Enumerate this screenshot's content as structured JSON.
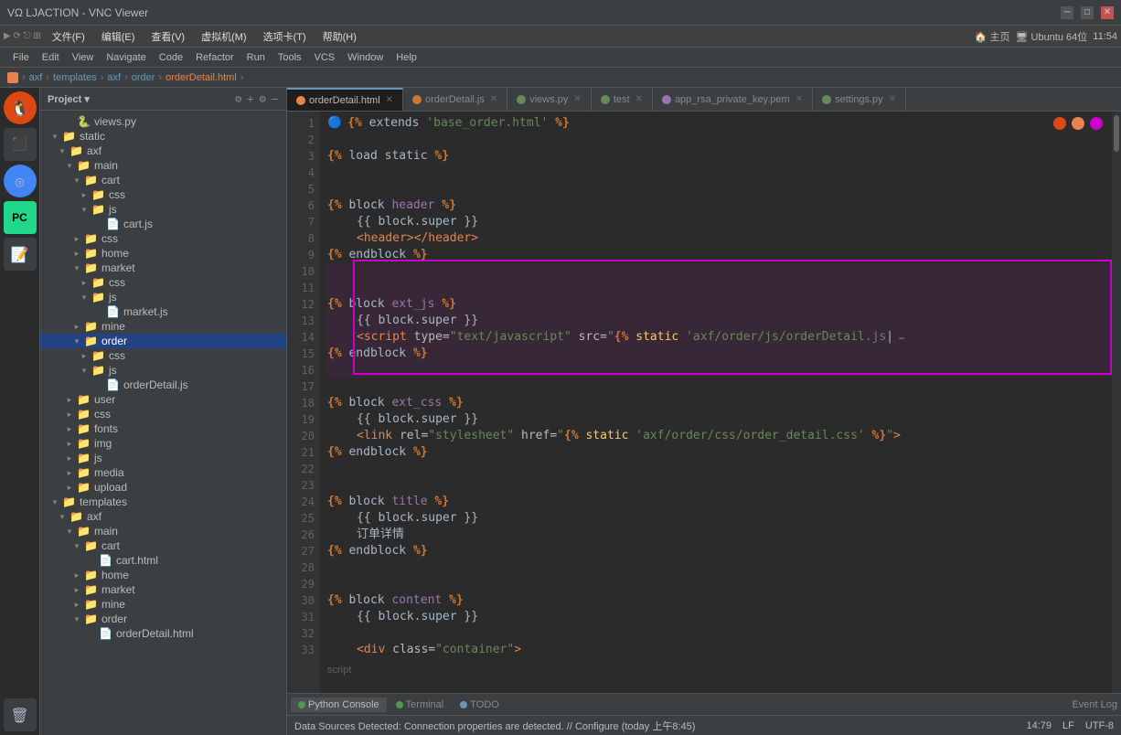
{
  "window": {
    "title": "VΩ LJACTION - VNC Viewer",
    "controls": [
      "minimize",
      "maximize",
      "close"
    ]
  },
  "vnc_toolbar": {
    "items": [
      "文件(F)",
      "编辑(E)",
      "查看(V)",
      "虚拟机(M)",
      "选项卡(T)",
      "帮助(H)"
    ]
  },
  "toolbar_right": {
    "label": "Ubuntu 64位",
    "time": "11:54"
  },
  "ide_menu": {
    "items": [
      "File",
      "Edit",
      "View",
      "Navigate",
      "Code",
      "Refactor",
      "Run",
      "Tools",
      "VCS",
      "Window",
      "Help"
    ]
  },
  "breadcrumb": {
    "items": [
      "axf",
      "templates",
      "axf",
      "order",
      "orderDetail.html"
    ]
  },
  "project_panel": {
    "title": "Project"
  },
  "tree": [
    {
      "level": 1,
      "type": "file",
      "name": "views.py",
      "indent": 24
    },
    {
      "level": 1,
      "type": "folder",
      "name": "static",
      "indent": 8,
      "expanded": true
    },
    {
      "level": 2,
      "type": "folder",
      "name": "axf",
      "indent": 16,
      "expanded": true
    },
    {
      "level": 3,
      "type": "folder",
      "name": "main",
      "indent": 24,
      "expanded": true
    },
    {
      "level": 4,
      "type": "folder",
      "name": "cart",
      "indent": 32,
      "expanded": true
    },
    {
      "level": 5,
      "type": "folder",
      "name": "css",
      "indent": 40,
      "expanded": false
    },
    {
      "level": 5,
      "type": "folder",
      "name": "js",
      "indent": 40,
      "expanded": true
    },
    {
      "level": 6,
      "type": "file",
      "name": "cart.js",
      "indent": 56
    },
    {
      "level": 4,
      "type": "folder",
      "name": "css",
      "indent": 32,
      "expanded": false
    },
    {
      "level": 4,
      "type": "folder",
      "name": "home",
      "indent": 32,
      "expanded": false
    },
    {
      "level": 4,
      "type": "folder",
      "name": "market",
      "indent": 32,
      "expanded": true
    },
    {
      "level": 5,
      "type": "folder",
      "name": "css",
      "indent": 40,
      "expanded": false
    },
    {
      "level": 5,
      "type": "folder",
      "name": "js",
      "indent": 40,
      "expanded": true
    },
    {
      "level": 6,
      "type": "file",
      "name": "market.js",
      "indent": 56
    },
    {
      "level": 4,
      "type": "folder",
      "name": "mine",
      "indent": 32,
      "expanded": false
    },
    {
      "level": 4,
      "type": "folder",
      "name": "order",
      "indent": 32,
      "expanded": true,
      "selected": true
    },
    {
      "level": 5,
      "type": "folder",
      "name": "css",
      "indent": 40,
      "expanded": false
    },
    {
      "level": 5,
      "type": "folder",
      "name": "js",
      "indent": 40,
      "expanded": true
    },
    {
      "level": 6,
      "type": "file",
      "name": "orderDetail.js",
      "indent": 56
    },
    {
      "level": 3,
      "type": "folder",
      "name": "user",
      "indent": 24,
      "expanded": false
    },
    {
      "level": 3,
      "type": "folder",
      "name": "css",
      "indent": 24,
      "expanded": false
    },
    {
      "level": 3,
      "type": "folder",
      "name": "fonts",
      "indent": 24,
      "expanded": false
    },
    {
      "level": 3,
      "type": "folder",
      "name": "img",
      "indent": 24,
      "expanded": false
    },
    {
      "level": 3,
      "type": "folder",
      "name": "js",
      "indent": 24,
      "expanded": false
    },
    {
      "level": 3,
      "type": "folder",
      "name": "media",
      "indent": 24,
      "expanded": false
    },
    {
      "level": 3,
      "type": "folder",
      "name": "upload",
      "indent": 24,
      "expanded": false
    },
    {
      "level": 1,
      "type": "folder",
      "name": "templates",
      "indent": 8,
      "expanded": true
    },
    {
      "level": 2,
      "type": "folder",
      "name": "axf",
      "indent": 16,
      "expanded": true
    },
    {
      "level": 3,
      "type": "folder",
      "name": "main",
      "indent": 24,
      "expanded": true
    },
    {
      "level": 4,
      "type": "folder",
      "name": "cart",
      "indent": 32,
      "expanded": true
    },
    {
      "level": 5,
      "type": "file",
      "name": "cart.html",
      "indent": 48
    },
    {
      "level": 4,
      "type": "folder",
      "name": "home",
      "indent": 32,
      "expanded": false
    },
    {
      "level": 4,
      "type": "folder",
      "name": "market",
      "indent": 32,
      "expanded": false
    },
    {
      "level": 4,
      "type": "folder",
      "name": "mine",
      "indent": 32,
      "expanded": false
    },
    {
      "level": 4,
      "type": "folder",
      "name": "order",
      "indent": 32,
      "expanded": true
    },
    {
      "level": 5,
      "type": "file",
      "name": "orderDetail.html",
      "indent": 48
    }
  ],
  "tabs": [
    {
      "label": "orderDetail.html",
      "type": "html",
      "active": true
    },
    {
      "label": "orderDetail.js",
      "type": "js",
      "active": false
    },
    {
      "label": "views.py",
      "type": "py",
      "active": false
    },
    {
      "label": "test",
      "type": "py",
      "active": false
    },
    {
      "label": "app_rsa_private_key.pem",
      "type": "pem",
      "active": false
    },
    {
      "label": "settings.py",
      "type": "py",
      "active": false
    }
  ],
  "code_lines": [
    {
      "num": 1,
      "content": "{% extends 'base_order.html' %}"
    },
    {
      "num": 2,
      "content": ""
    },
    {
      "num": 3,
      "content": "{% load static %}"
    },
    {
      "num": 4,
      "content": ""
    },
    {
      "num": 5,
      "content": ""
    },
    {
      "num": 6,
      "content": "{% block header %}"
    },
    {
      "num": 7,
      "content": "    {{ block.super }}"
    },
    {
      "num": 8,
      "content": "    <header></header>"
    },
    {
      "num": 9,
      "content": "{% endblock %}"
    },
    {
      "num": 10,
      "content": ""
    },
    {
      "num": 11,
      "content": ""
    },
    {
      "num": 12,
      "content": "{% block ext_js %}"
    },
    {
      "num": 13,
      "content": "    {{ block.super }}"
    },
    {
      "num": 14,
      "content": "    <script type=\"text/javascript\" src=\"{% static 'axf/order/js/orderDetail.js'"
    },
    {
      "num": 15,
      "content": "{% endblock %}"
    },
    {
      "num": 16,
      "content": ""
    },
    {
      "num": 17,
      "content": ""
    },
    {
      "num": 18,
      "content": "{% block ext_css %}"
    },
    {
      "num": 19,
      "content": "    {{ block.super }}"
    },
    {
      "num": 20,
      "content": "    <link rel=\"stylesheet\" href=\"{% static 'axf/order/css/order_detail.css' %}\">"
    },
    {
      "num": 21,
      "content": "{% endblock %}"
    },
    {
      "num": 22,
      "content": ""
    },
    {
      "num": 23,
      "content": ""
    },
    {
      "num": 24,
      "content": "{% block title %}"
    },
    {
      "num": 25,
      "content": "    {{ block.super }}"
    },
    {
      "num": 26,
      "content": "    订单详情"
    },
    {
      "num": 27,
      "content": "{% endblock %}"
    },
    {
      "num": 28,
      "content": ""
    },
    {
      "num": 29,
      "content": ""
    },
    {
      "num": 30,
      "content": "{% block content %}"
    },
    {
      "num": 31,
      "content": "    {{ block.super }}"
    },
    {
      "num": 32,
      "content": ""
    },
    {
      "num": 33,
      "content": "    <div class=\"container\">"
    }
  ],
  "status_bar": {
    "left": "Data Sources Detected: Connection properties are detected. // Configure (today 上午8:45)",
    "right": "14:79  LF  UTF-8",
    "event_log": "Event Log"
  },
  "bottom_tabs": [
    {
      "label": "Python Console",
      "dot": "green"
    },
    {
      "label": "Terminal",
      "dot": "green"
    },
    {
      "label": "TODO",
      "dot": "blue"
    }
  ]
}
